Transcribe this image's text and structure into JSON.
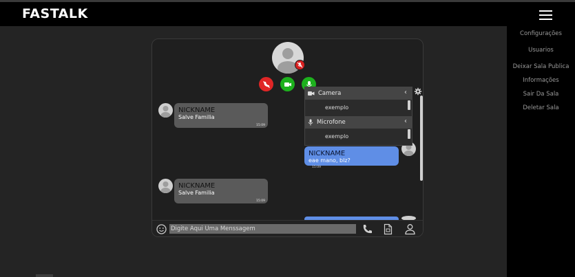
{
  "app": {
    "title": "FASTALK"
  },
  "menu": {
    "icon": "hamburger-menu-icon",
    "items": [
      {
        "label": "Configurações"
      },
      {
        "label": "Usuarios"
      },
      {
        "label": "Deixar Sala Publica"
      },
      {
        "label": "Informações"
      },
      {
        "label": "Sair Da Sala"
      },
      {
        "label": "Deletar Sala"
      }
    ]
  },
  "call": {
    "controls": [
      {
        "icon": "phone-hangup-icon",
        "color": "#e02626"
      },
      {
        "icon": "video-camera-icon",
        "color": "#1db11d"
      },
      {
        "icon": "microphone-icon",
        "color": "#1db11d"
      }
    ],
    "muted_badge_color": "#d82020"
  },
  "messages": [
    {
      "side": "left",
      "nickname": "NICKNAME",
      "text": "Salve Familia",
      "time": "15:09"
    },
    {
      "side": "right",
      "nickname": "NICKNAME",
      "text": "eae mano, blz?",
      "time": "15:09"
    },
    {
      "side": "left",
      "nickname": "NICKNAME",
      "text": "Salve Familia",
      "time": "15:09"
    }
  ],
  "device_settings": {
    "camera": {
      "label": "Camera",
      "option": "exemplo"
    },
    "microphone": {
      "label": "Microfone",
      "option": "exemplo"
    }
  },
  "composer": {
    "placeholder": "Digite Aqui Uma Menssagem"
  },
  "colors": {
    "background": "#242424",
    "topbar": "#000000",
    "bubble_left": "#5a5a5a",
    "bubble_right": "#5f8ee6",
    "hangup": "#e02626",
    "active": "#1db11d"
  }
}
